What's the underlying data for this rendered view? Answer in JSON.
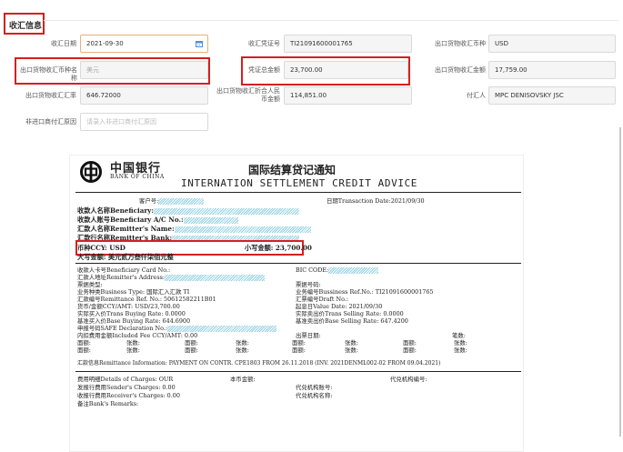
{
  "section": {
    "title": "收汇信息"
  },
  "form": {
    "receipt_date_label": "收汇日期",
    "receipt_date_value": "2021-09-30",
    "receipt_voucher_label": "收汇凭证号",
    "receipt_voucher_value": "TI21091600001765",
    "export_receipt_currency_label": "出口货物收汇币种",
    "export_receipt_currency_value": "USD",
    "export_currency_name_label": "出口货物收汇币种名称",
    "export_currency_name_value": "美元",
    "voucher_amount_label": "凭证总金额",
    "voucher_amount_value": "23,700.00",
    "export_receipt_amount_label": "出口货物收汇金额",
    "export_receipt_amount_value": "17,759.00",
    "export_exchange_rate_label": "出口货物收汇汇率",
    "export_exchange_rate_value": "646.72000",
    "export_rmb_amount_label": "出口货物收汇折合人民币金额",
    "export_rmb_amount_value": "114,851.00",
    "remitter_label": "付汇人",
    "remitter_value": "MPC DENISOVSKY JSC",
    "non_import_reason_label": "非进口商付汇原因",
    "non_import_reason_placeholder": "请录入非进口商付汇原因"
  },
  "document": {
    "bank_cn": "中国银行",
    "bank_en": "BANK OF CHINA",
    "title_cn": "国际结算贷记通知",
    "title_en": "INTERNATION SETTLEMENT CREDIT ADVICE",
    "customer_no": "客户号:",
    "date": "日期Transaction Date:2021/09/30",
    "beneficiary": "收款人名称Beneficiary:",
    "beneficiary_ac": "收款人账号Beneficiary A/C No.:",
    "remitter_name": "汇款人名称Remitter's Name:",
    "remitter_bank": "汇款行名称Remitter's Bank:",
    "ccy": "币种CCY: USD",
    "small_amount": "小写金额: 23,700.00",
    "big_amount": "大写金额: 美元贰万叁仟柒佰元整",
    "card_no": "收款人卡号Beneficiary Card No.:",
    "bic_code": "BIC CODE:",
    "remitter_address": "汇款人地址Remitter's Address:",
    "ticket_type": "票据类型:",
    "ticket_no": "票据号码:",
    "business_type": "业务种类Business Type: 国际汇入汇款  TI",
    "business_ref": "业务编号Bussiness Ref.No.: TI21091600001765",
    "remittance_ref": "汇款编号Remittance Ref. No.: 50612582211B01",
    "draft_no": "汇票编号Draft No.:",
    "ccy_amt": "货币/金额CCY/AMT: USD/23,700.00",
    "value_date": "起息日Value Date: 2021/09/30",
    "buying_rate": "实际买入价Trans Buying Rate: 0.0000",
    "selling_rate": "实际卖出价Trans Selling Rate: 0.0000",
    "base_buying_rate": "基准买入价Base Buying Rate: 644.6900",
    "base_selling_rate": "基准卖出价Base Selling Rate: 647.4200",
    "safe_no": "申报号码SAFE Declaration No.:",
    "fee_included": "内扣费用金额Included Fee CCY/AMT: 0.00",
    "exit_date": "出票日期:",
    "count": "笔数:",
    "face_value": "面额:",
    "sheets": "张数:",
    "remit_info": "汇款信息Remittance Information: PAYMENT ON CONTR. CPE1803 FROM 26.11.2018 (INV. 2021DENML002-02 FROM 09.04.2021)",
    "details_charges": "费用明细Details of Charges: OUR",
    "rmb_amount": "本币金额:",
    "agent_no": "代兑机构编号:",
    "sender_charges": "发报行费用Sender's Charges: 0.00",
    "agent_account": "代兑机构账号:",
    "receiver_charges": "收报行费用Receiver's Charges: 0.00",
    "agent_name": "代兑机构名称:",
    "remarks": "备注Bank's Remarks:"
  }
}
